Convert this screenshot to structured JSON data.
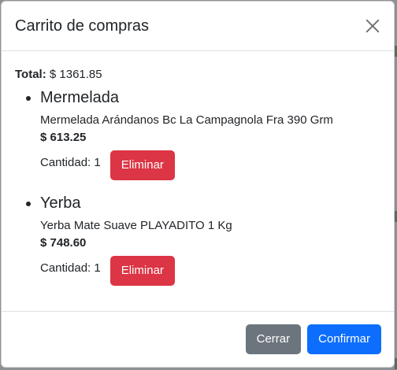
{
  "modal": {
    "title": "Carrito de compras",
    "close_icon": "close-icon"
  },
  "cart": {
    "total_label": "Total:",
    "total_value": "$ 1361.85",
    "items": [
      {
        "name": "Mermelada",
        "description": "Mermelada Arándanos Bc La Campagnola Fra 390 Grm",
        "price": "$ 613.25",
        "quantity": "Cantidad: 1",
        "remove_label": "Eliminar"
      },
      {
        "name": "Yerba",
        "description": "Yerba Mate Suave PLAYADITO 1 Kg",
        "price": "$ 748.60",
        "quantity": "Cantidad: 1",
        "remove_label": "Eliminar"
      }
    ]
  },
  "footer": {
    "close_label": "Cerrar",
    "confirm_label": "Confirmar"
  },
  "colors": {
    "danger": "#dc3545",
    "secondary": "#6c757d",
    "primary": "#0d6efd"
  }
}
